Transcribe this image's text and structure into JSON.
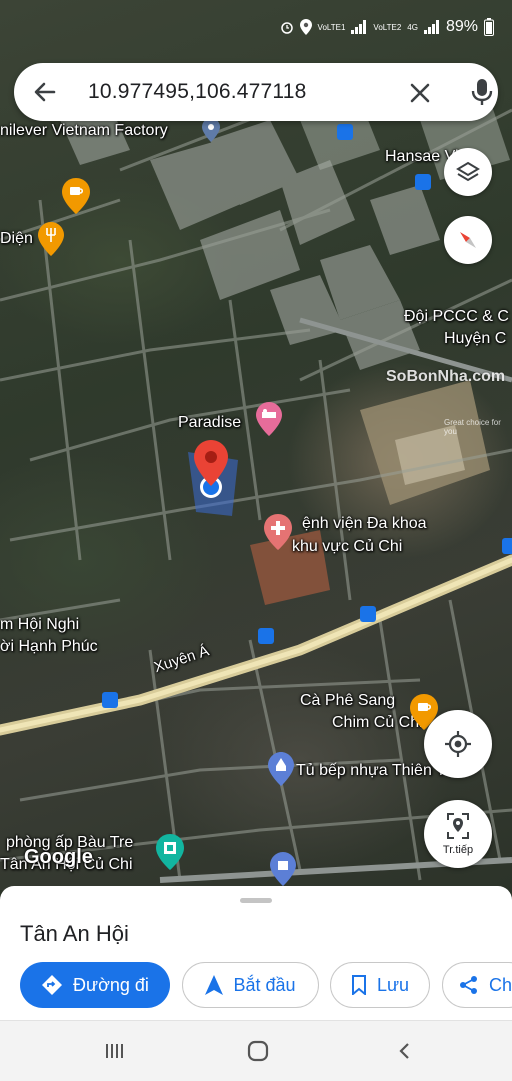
{
  "status_bar": {
    "net1": "VoLTE1",
    "net2": "VoLTE2",
    "net_type": "4G",
    "battery": "89%"
  },
  "search": {
    "query": "10.977495,106.477118"
  },
  "map_labels": {
    "unilever": "nilever Vietnam Factory",
    "hansae": "Hansae Vi",
    "dien": "Diện",
    "pccc_line1": "Đội PCCC & C",
    "pccc_line2": "Huyện C",
    "paradise": "Paradise",
    "hospital_line1": "ệnh viện Đa khoa",
    "hospital_line2": "khu vực Củ Chi",
    "hoinghi_line1": "m Hội Nghi",
    "hoinghi_line2": "ời Hạnh Phúc",
    "road": "Xuyên Á",
    "cafe_line1": "Cà Phê Sang",
    "cafe_line2": "Chim Củ Chi",
    "tubep": "Tủ bếp nhựa Thiên Tân",
    "phong_line1": "phòng ấp Bàu Tre",
    "phong_line2": "Tân An Hội Củ Chi",
    "watermark_logo": "SoBonNha.com",
    "watermark_sub": "Great choice for you",
    "google": "Google"
  },
  "map_buttons": {
    "next_label": "Tr.tiếp"
  },
  "sheet": {
    "place_title": "Tân An Hội",
    "directions_label": "Đường đi",
    "start_label": "Bắt đầu",
    "save_label": "Lưu",
    "share_label": "Ch"
  },
  "colors": {
    "accent": "#1a73e8",
    "pin_red": "#ea4335",
    "map_road": "#d8cc9a"
  },
  "icons": {
    "back": "arrow-left-icon",
    "clear": "close-icon",
    "mic": "microphone-icon",
    "layers": "layers-icon",
    "compass": "compass-icon",
    "my_location": "crosshair-icon",
    "next": "street-view-icon"
  }
}
